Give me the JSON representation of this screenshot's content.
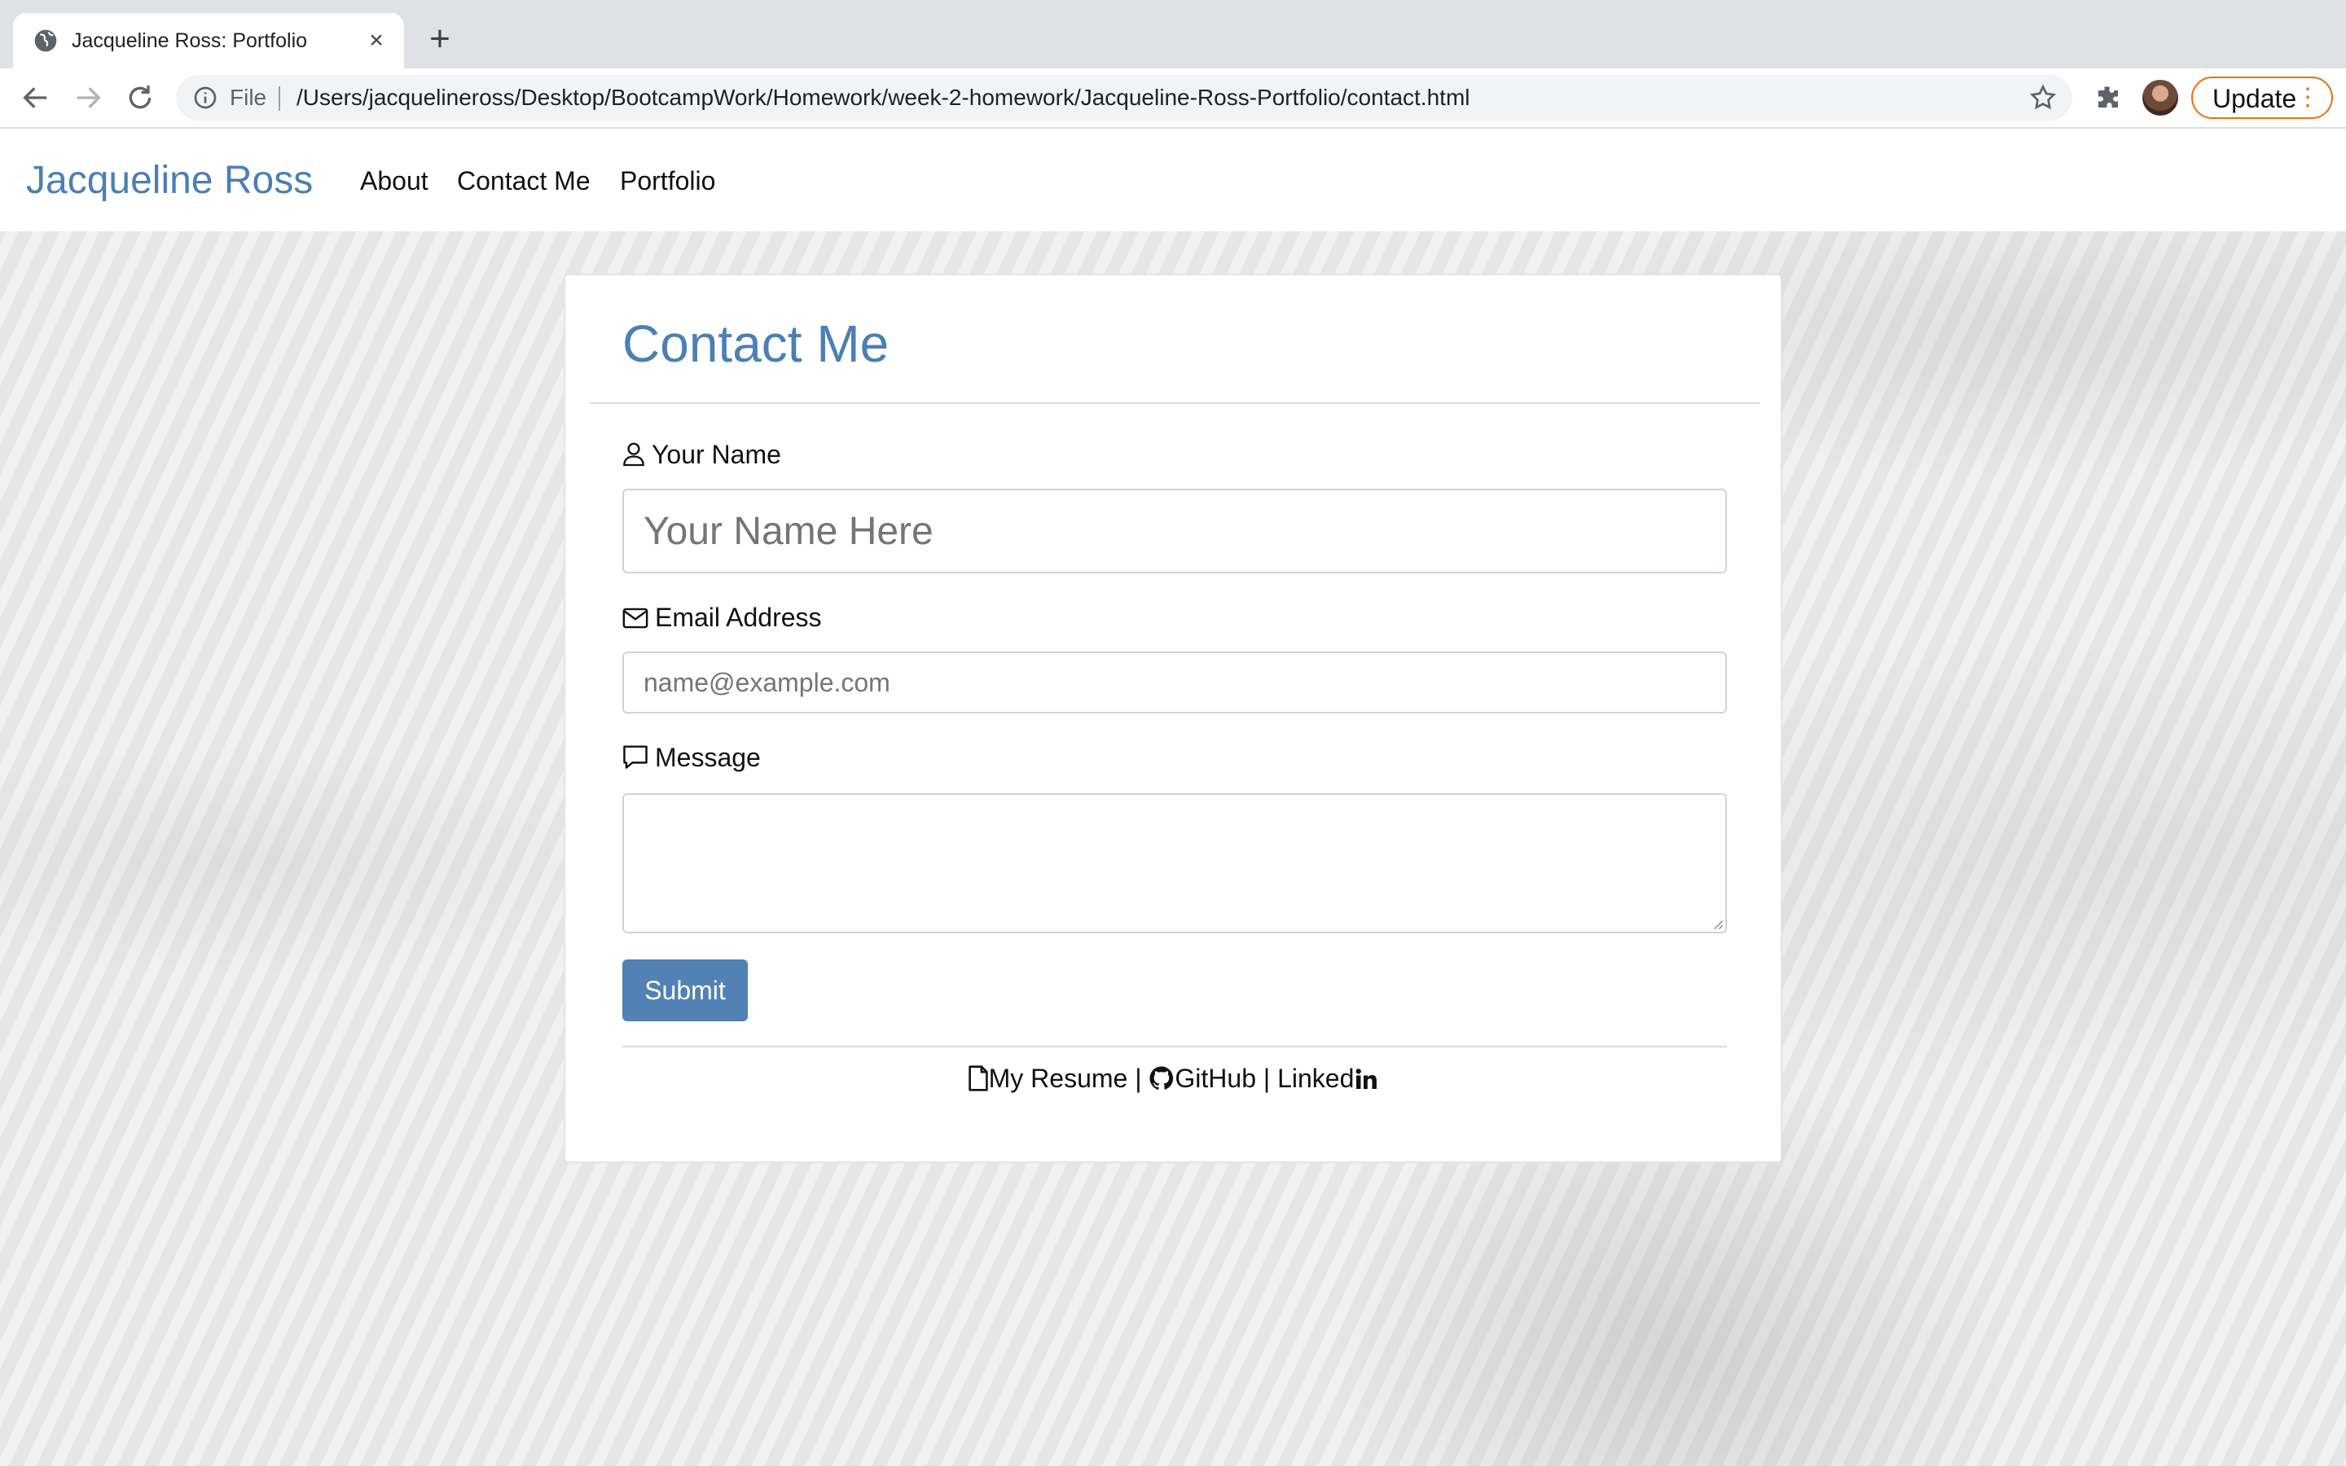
{
  "browser": {
    "tab_title": "Jacqueline Ross: Portfolio",
    "scheme_label": "File",
    "url": "/Users/jacquelineross/Desktop/BootcampWork/Homework/week-2-homework/Jacqueline-Ross-Portfolio/contact.html",
    "update_label": "Update"
  },
  "navbar": {
    "brand": "Jacqueline Ross",
    "links": [
      "About",
      "Contact Me",
      "Portfolio"
    ]
  },
  "contact": {
    "title": "Contact Me",
    "name_label": "Your Name",
    "name_placeholder": "Your Name Here",
    "email_label": "Email Address",
    "email_placeholder": "name@example.com",
    "message_label": "Message",
    "submit_label": "Submit"
  },
  "footer": {
    "resume": "My Resume",
    "separator": "|",
    "github": "GitHub",
    "linkedin": "Linked"
  },
  "colors": {
    "accent": "#4c7fb3",
    "button": "#5181b5",
    "update": "#e8710a"
  }
}
